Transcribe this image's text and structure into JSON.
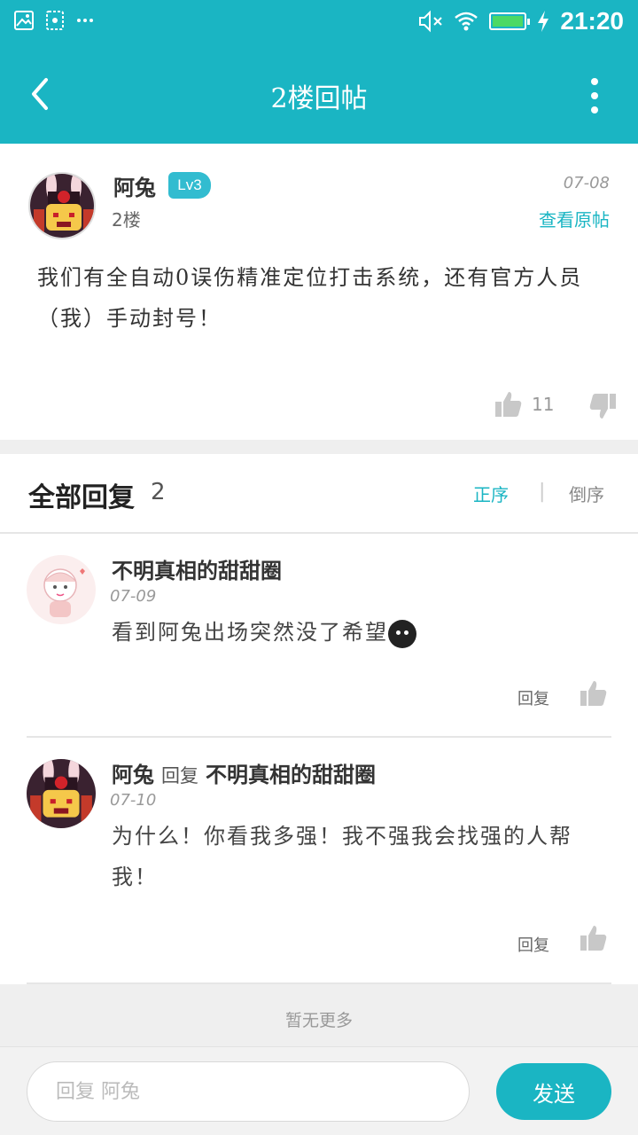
{
  "status_bar": {
    "time": "21:20",
    "icons": [
      "image-icon",
      "screenshot-icon",
      "more-notifications-icon",
      "mute-icon",
      "wifi-icon",
      "battery-icon",
      "charging-icon"
    ]
  },
  "app_bar": {
    "title": "2楼回帖",
    "back_icon": "chevron-left-icon",
    "menu_icon": "more-vertical-icon"
  },
  "post": {
    "author": "阿兔",
    "level": "Lv3",
    "floor": "2楼",
    "date": "07-08",
    "view_original": "查看原帖",
    "content": "我们有全自动0误伤精准定位打击系统，还有官方人员（我）手动封号！",
    "like_count": "11"
  },
  "replies": {
    "title": "全部回复",
    "count": "2",
    "sort_asc": "正序",
    "sort_sep": "|",
    "sort_desc": "倒序",
    "items": [
      {
        "author": "不明真相的甜甜圈",
        "date": "07-09",
        "text": "看到阿兔出场突然没了希望",
        "reply_label": "回复"
      },
      {
        "author": "阿兔",
        "reply_word": "回复",
        "reply_to": "不明真相的甜甜圈",
        "date": "07-10",
        "text": "为什么！你看我多强！我不强我会找强的人帮我！",
        "reply_label": "回复"
      }
    ]
  },
  "footer": {
    "no_more": "暂无更多"
  },
  "composer": {
    "placeholder": "回复 阿兔",
    "send_label": "发送"
  },
  "colors": {
    "primary": "#1ab5c3",
    "level_badge": "#32bcd0",
    "battery": "#4cd964"
  }
}
